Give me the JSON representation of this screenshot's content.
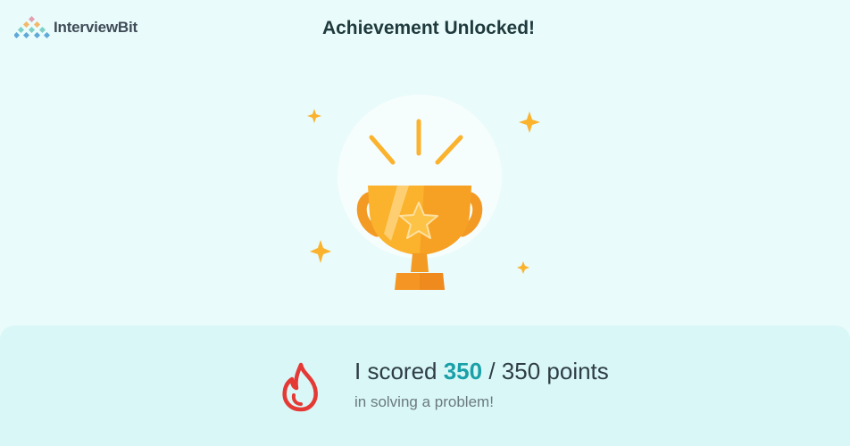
{
  "header": {
    "logo_text": "InterviewBit",
    "title": "Achievement Unlocked!"
  },
  "score": {
    "prefix": "I scored ",
    "value": "350",
    "separator": " / ",
    "total": "350",
    "suffix": " points",
    "subtext": "in solving a problem!"
  },
  "icons": {
    "logo": "interviewbit-logo-icon",
    "trophy": "trophy-icon",
    "sparkle": "sparkle-icon",
    "fire": "fire-icon"
  },
  "colors": {
    "background": "#e9fbfa",
    "card": "#d9f7f6",
    "accent": "#1aa0a8",
    "trophy": "#fbb22c",
    "fire": "#e53935"
  }
}
